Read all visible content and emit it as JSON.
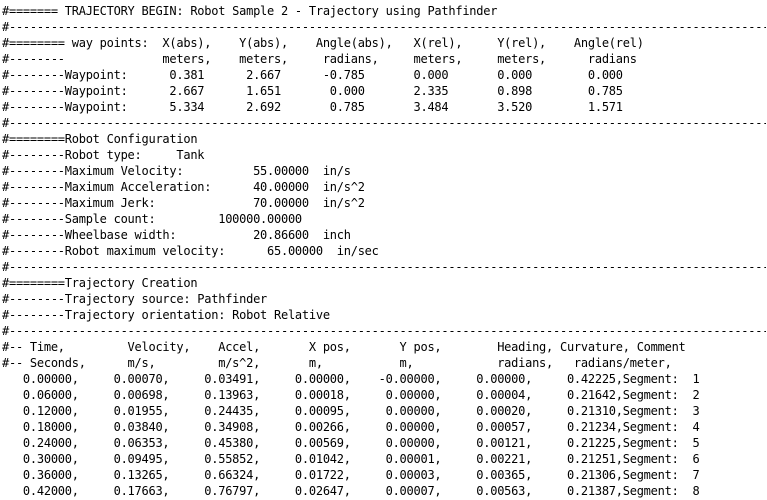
{
  "lines": [
    "#======= TRAJECTORY BEGIN: Robot Sample 2 - Trajectory using Pathfinder",
    "#----------------------------------------------------------------------------------------------------------------",
    "#======== way points:  X(abs),    Y(abs),    Angle(abs),   X(rel),     Y(rel),    Angle(rel)",
    "#--------              meters,    meters,     radians,     meters,     meters,      radians",
    "#--------Waypoint:      0.381      2.667      -0.785       0.000       0.000        0.000",
    "#--------Waypoint:      2.667      1.651       0.000       2.335       0.898        0.785",
    "#--------Waypoint:      5.334      2.692       0.785       3.484       3.520        1.571",
    "#----------------------------------------------------------------------------------------------------------------",
    "#========Robot Configuration",
    "#--------Robot type:     Tank",
    "#--------Maximum Velocity:          55.00000  in/s",
    "#--------Maximum Acceleration:      40.00000  in/s^2",
    "#--------Maximum Jerk:              70.00000  in/s^2",
    "#--------Sample count:         100000.00000",
    "#--------Wheelbase width:           20.86600  inch",
    "#--------Robot maximum velocity:      65.00000  in/sec",
    "#----------------------------------------------------------------------------------------------------------------",
    "#========Trajectory Creation",
    "#--------Trajectory source: Pathfinder",
    "#--------Trajectory orientation: Robot Relative",
    "#----------------------------------------------------------------------------------------------------------------",
    "#-- Time,         Velocity,    Accel,       X pos,       Y pos,        Heading, Curvature, Comment",
    "#-- Seconds,      m/s,         m/s^2,       m,           m,            radians,   radians/meter,",
    "   0.00000,     0.00070,     0.03491,     0.00000,    -0.00000,     0.00000,     0.42225,Segment:  1",
    "   0.06000,     0.00698,     0.13963,     0.00018,     0.00000,     0.00004,     0.21642,Segment:  2",
    "   0.12000,     0.01955,     0.24435,     0.00095,     0.00000,     0.00020,     0.21310,Segment:  3",
    "   0.18000,     0.03840,     0.34908,     0.00266,     0.00000,     0.00057,     0.21234,Segment:  4",
    "   0.24000,     0.06353,     0.45380,     0.00569,     0.00000,     0.00121,     0.21225,Segment:  5",
    "   0.30000,     0.09495,     0.55852,     0.01042,     0.00001,     0.00221,     0.21251,Segment:  6",
    "   0.36000,     0.13265,     0.66324,     0.01722,     0.00003,     0.00365,     0.21306,Segment:  7",
    "   0.42000,     0.17663,     0.76797,     0.02647,     0.00007,     0.00563,     0.21387,Segment:  8"
  ]
}
